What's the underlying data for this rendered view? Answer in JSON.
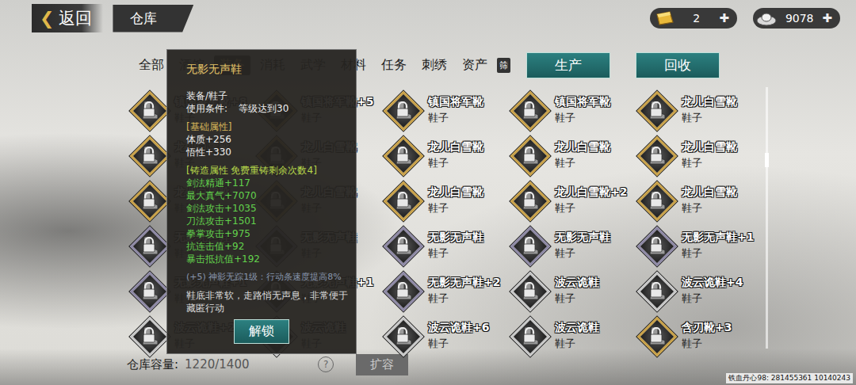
{
  "topbar": {
    "back_icon": "❮",
    "back": "返回",
    "title": "仓库",
    "currencies": [
      {
        "kind": "gold",
        "amount": "2",
        "add_icon": "✚"
      },
      {
        "kind": "silver",
        "amount": "9078",
        "add_icon": "✚"
      }
    ]
  },
  "tabs": [
    {
      "label": "全部",
      "selected": false
    },
    {
      "label": "酒馆",
      "selected": false
    },
    {
      "label": "装备",
      "selected": true
    },
    {
      "label": "消耗",
      "selected": false
    },
    {
      "label": "武学",
      "selected": false
    },
    {
      "label": "材料",
      "selected": false
    },
    {
      "label": "任务",
      "selected": false
    },
    {
      "label": "刺绣",
      "selected": false
    },
    {
      "label": "资产",
      "selected": false
    }
  ],
  "filter_button": "筛",
  "actions": [
    "生产",
    "回收"
  ],
  "items": [
    {
      "name": "镇国将军靴+8",
      "type": "鞋子",
      "locked": true,
      "color": "#c9a24a"
    },
    {
      "name": "镇国将军靴+5",
      "type": "鞋子",
      "locked": true,
      "color": "#c9a24a"
    },
    {
      "name": "镇国将军靴",
      "type": "鞋子",
      "locked": true,
      "color": "#c9a24a"
    },
    {
      "name": "镇国将军靴",
      "type": "鞋子",
      "locked": true,
      "color": "#c9a24a"
    },
    {
      "name": "龙儿白雪靴",
      "type": "鞋子",
      "locked": true,
      "color": "#c9a24a"
    },
    {
      "name": "龙儿白雪靴",
      "type": "鞋子",
      "locked": true,
      "color": "#c9a24a"
    },
    {
      "name": "龙儿白雪靴",
      "type": "鞋子",
      "locked": true,
      "color": "#c9a24a"
    },
    {
      "name": "龙儿白雪靴",
      "type": "鞋子",
      "locked": true,
      "color": "#c9a24a"
    },
    {
      "name": "龙儿白雪靴",
      "type": "鞋子",
      "locked": true,
      "color": "#c9a24a"
    },
    {
      "name": "龙儿白雪靴",
      "type": "鞋子",
      "locked": true,
      "color": "#c9a24a"
    },
    {
      "name": "龙儿白雪靴",
      "type": "鞋子",
      "locked": true,
      "color": "#c9a24a"
    },
    {
      "name": "龙儿白雪靴",
      "type": "鞋子",
      "locked": true,
      "color": "#c9a24a"
    },
    {
      "name": "龙儿白雪靴",
      "type": "鞋子",
      "locked": true,
      "color": "#c9a24a"
    },
    {
      "name": "龙儿白雪靴+2",
      "type": "鞋子",
      "locked": true,
      "color": "#c9a24a"
    },
    {
      "name": "龙儿白雪靴",
      "type": "鞋子",
      "locked": true,
      "color": "#c9a24a"
    },
    {
      "name": "无影无声鞋",
      "type": "鞋子",
      "locked": true,
      "color": "#8f8aa6"
    },
    {
      "name": "无影无声鞋",
      "type": "鞋子",
      "locked": true,
      "color": "#8f8aa6"
    },
    {
      "name": "无影无声鞋",
      "type": "鞋子",
      "locked": true,
      "color": "#8f8aa6"
    },
    {
      "name": "无影无声鞋",
      "type": "鞋子",
      "locked": true,
      "color": "#8f8aa6"
    },
    {
      "name": "无影无声鞋+1",
      "type": "鞋子",
      "locked": true,
      "color": "#8f8aa6"
    },
    {
      "name": "无影无声鞋+1",
      "type": "鞋子",
      "locked": true,
      "color": "#8f8aa6"
    },
    {
      "name": "无影无声鞋+1",
      "type": "鞋子",
      "locked": true,
      "color": "#8f8aa6"
    },
    {
      "name": "无影无声鞋+2",
      "type": "鞋子",
      "locked": true,
      "color": "#8f8aa6"
    },
    {
      "name": "波云诡鞋",
      "type": "鞋子",
      "locked": true,
      "color": "#c8c8c8"
    },
    {
      "name": "波云诡鞋+4",
      "type": "鞋子",
      "locked": true,
      "color": "#c8c8c8"
    },
    {
      "name": "波云诡鞋+2",
      "type": "鞋子",
      "locked": true,
      "color": "#c8c8c8"
    },
    {
      "name": "波云诡鞋",
      "type": "鞋子",
      "locked": true,
      "color": "#c8c8c8"
    },
    {
      "name": "波云诡鞋+6",
      "type": "鞋子",
      "locked": true,
      "color": "#c8c8c8"
    },
    {
      "name": "波云诡鞋",
      "type": "鞋子",
      "locked": true,
      "color": "#c8c8c8"
    },
    {
      "name": "含刃靴+3",
      "type": "鞋子",
      "locked": true,
      "color": "#c9a24a"
    }
  ],
  "scrollbar": {
    "position": 0.25
  },
  "tooltip": {
    "title": "无影无声鞋",
    "category": "装备/鞋子",
    "requirement_label": "使用条件:",
    "requirement": "等级达到30",
    "base_label": "[基础属性]",
    "base_stats": [
      "体质+256",
      "悟性+330"
    ],
    "forge_label": "[铸造属性  免费重铸剩余次数4]",
    "forge_stats": [
      "剑法精通+117",
      "最大真气+7070",
      "剑法攻击+1035",
      "刀法攻击+1501",
      "拳掌攻击+975",
      "抗连击值+92",
      "暴击抵抗值+192"
    ],
    "skill": "(+5) 神影无踪1级：行动条速度提高8%",
    "description": "鞋底非常软，走路悄无声息，非常便于藏匿行动",
    "button": "解锁"
  },
  "footer": {
    "capacity_label": "仓库容量:",
    "capacity": "1220/1400",
    "help_icon": "?",
    "expand": "扩容"
  },
  "watermark": "铁血丹心98: 281455361 10140243"
}
